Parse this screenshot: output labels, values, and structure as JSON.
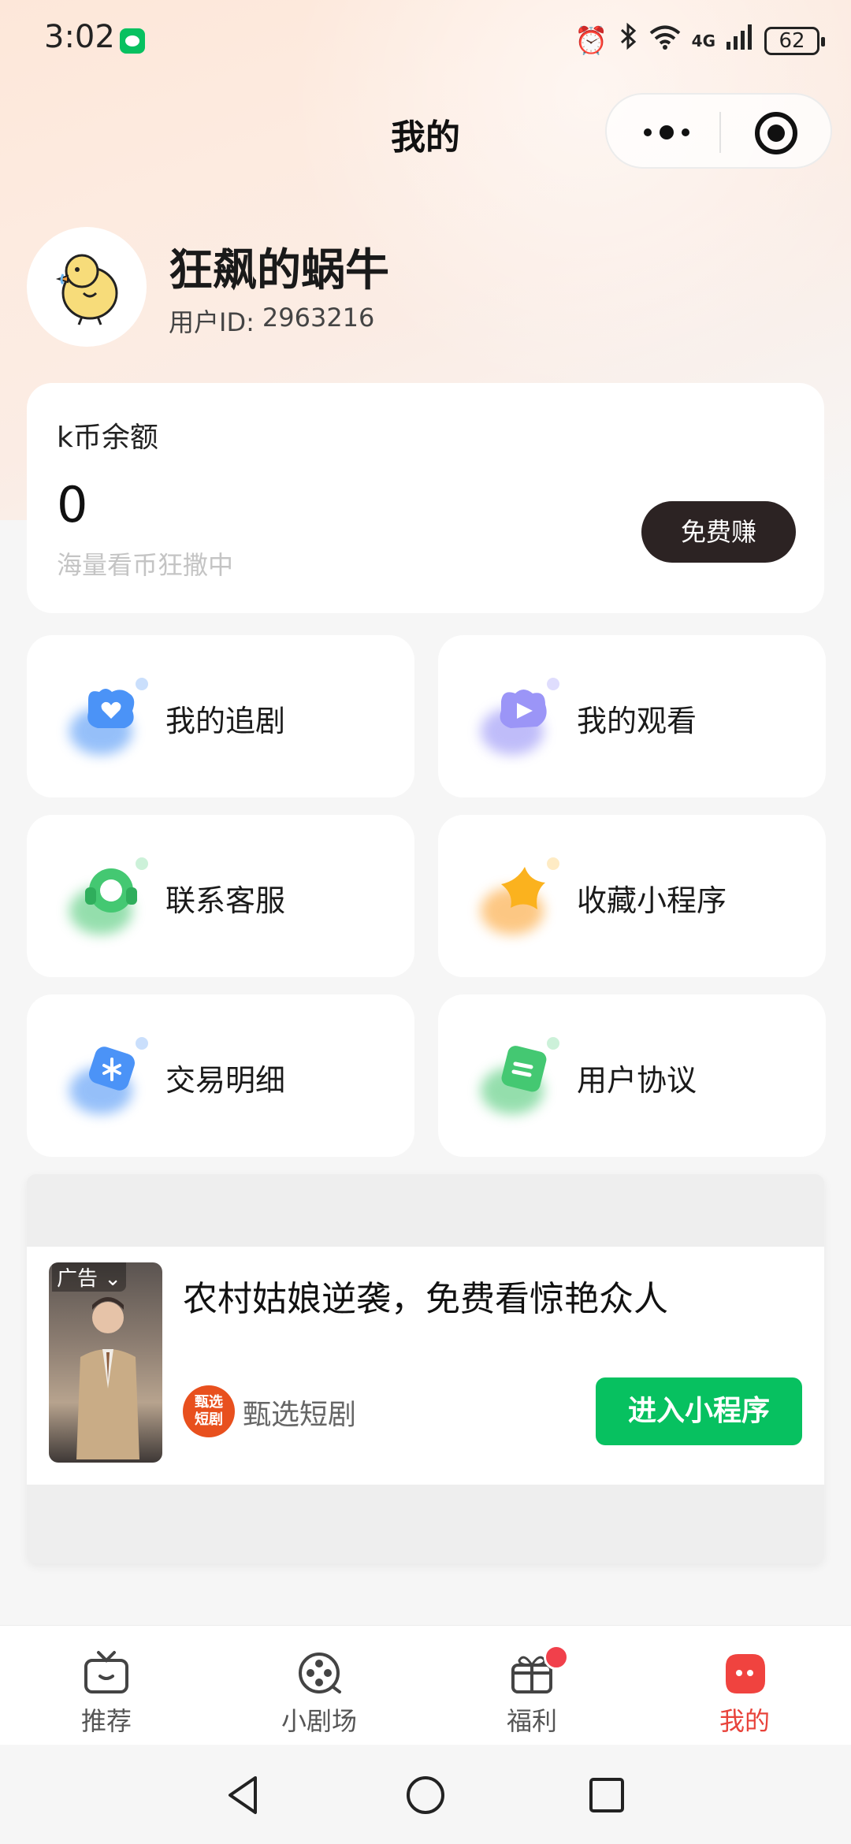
{
  "status_bar": {
    "time": "3:02",
    "network": "4G",
    "battery": "62",
    "icons": [
      "wechat-icon",
      "alarm-icon",
      "bluetooth-icon",
      "wifi-icon",
      "signal-icon",
      "battery-icon"
    ]
  },
  "header": {
    "title": "我的",
    "capsule_icons": [
      "more-icon",
      "close-target-icon"
    ]
  },
  "profile": {
    "nickname": "狂飙的蜗牛",
    "id_label": "用户ID:",
    "id_value": "2963216"
  },
  "coin_card": {
    "title": "k币余额",
    "value": "0",
    "subtitle": "海量看币狂撒中",
    "button": "免费赚"
  },
  "menu": [
    {
      "label": "我的追剧",
      "icon": "heart-drama-icon",
      "color": "#3f8cf5"
    },
    {
      "label": "我的观看",
      "icon": "watch-history-icon",
      "color": "#8b86f5"
    },
    {
      "label": "联系客服",
      "icon": "headset-icon",
      "color": "#3ec46a"
    },
    {
      "label": "收藏小程序",
      "icon": "star-icon",
      "color": "#fbb21e"
    },
    {
      "label": "交易明细",
      "icon": "transaction-icon",
      "color": "#3f8cf5"
    },
    {
      "label": "用户协议",
      "icon": "agreement-icon",
      "color": "#3ec46a"
    }
  ],
  "ad": {
    "tag": "广告",
    "title": "农村姑娘逆袭，免费看惊艳众人",
    "brand_logo": "甄选短剧",
    "brand_logo_line1": "甄选",
    "brand_logo_line2": "短剧",
    "brand_name": "甄选短剧",
    "cta": "进入小程序",
    "cta_color": "#07c160"
  },
  "tab_bar": {
    "tabs": [
      {
        "label": "推荐",
        "icon": "tv-icon"
      },
      {
        "label": "小剧场",
        "icon": "film-reel-icon"
      },
      {
        "label": "福利",
        "icon": "gift-icon",
        "badge": true
      },
      {
        "label": "我的",
        "icon": "profile-face-icon",
        "active": true
      }
    ],
    "active_color": "#e8433b"
  },
  "nav_bar": {
    "buttons": [
      "back-icon",
      "home-icon",
      "recents-icon"
    ]
  }
}
